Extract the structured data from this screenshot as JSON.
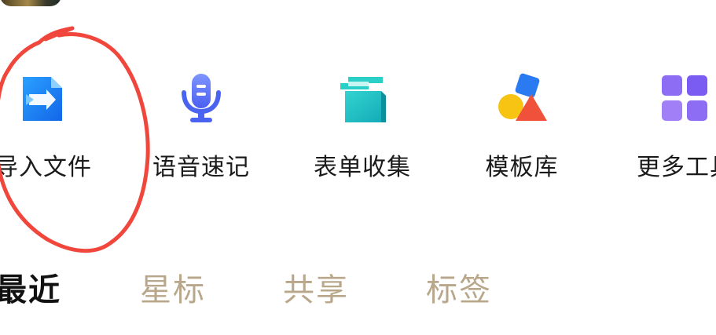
{
  "tools": [
    {
      "label": "导入文件",
      "icon": "import-file-icon",
      "color": "#1f8cf5"
    },
    {
      "label": "语音速记",
      "icon": "voice-memo-icon",
      "color": "#4f6ef0"
    },
    {
      "label": "表单收集",
      "icon": "form-collect-icon",
      "color": "#18b9c0"
    },
    {
      "label": "模板库",
      "icon": "template-library-icon",
      "color": "#f5a20b"
    },
    {
      "label": "更多工具",
      "icon": "more-tools-icon",
      "color": "#8a6cf5"
    }
  ],
  "tabs": [
    {
      "label": "最近",
      "active": true
    },
    {
      "label": "星标",
      "active": false
    },
    {
      "label": "共享",
      "active": false
    },
    {
      "label": "标签",
      "active": false
    }
  ],
  "colors": {
    "tab_active": "#111111",
    "tab_inactive": "#b8a78a",
    "annotation": "#f0463c"
  }
}
